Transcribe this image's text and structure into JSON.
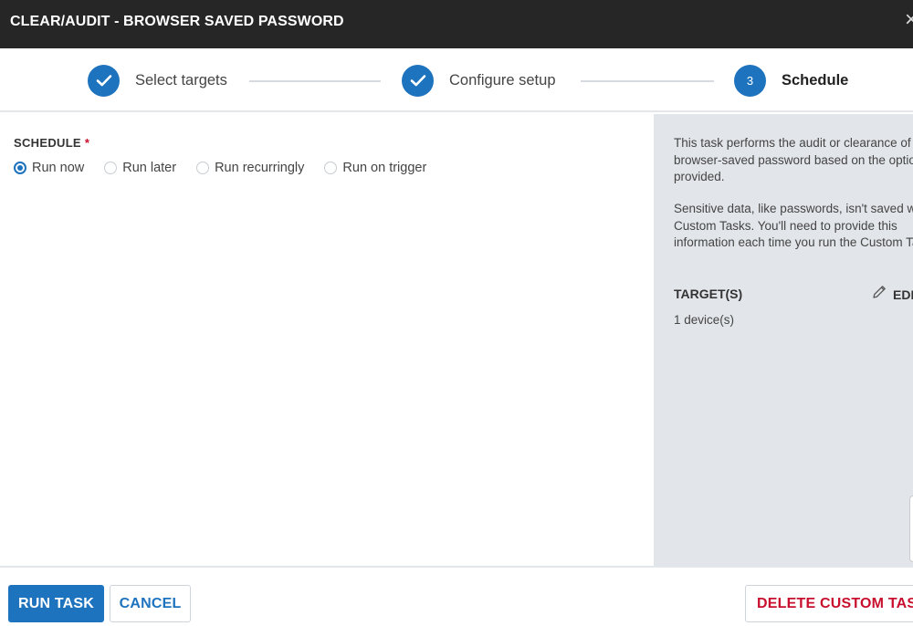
{
  "window": {
    "title": "CLEAR/AUDIT - BROWSER SAVED PASSWORD",
    "close_glyph": "×"
  },
  "stepper": {
    "steps": [
      {
        "label": "Select targets",
        "state": "completed",
        "icon": "check-icon"
      },
      {
        "label": "Configure setup",
        "state": "completed",
        "icon": "check-icon"
      },
      {
        "label": "Schedule",
        "state": "active",
        "number": "3"
      }
    ]
  },
  "schedule": {
    "label": "SCHEDULE",
    "required_marker": "*",
    "options": [
      {
        "label": "Run now",
        "checked": true
      },
      {
        "label": "Run later",
        "checked": false
      },
      {
        "label": "Run recurringly",
        "checked": false
      },
      {
        "label": "Run on trigger",
        "checked": false
      }
    ]
  },
  "info_panel": {
    "description": "This task performs the audit or clearance of the browser-saved password based on the option provided.",
    "sensitive_note": "Sensitive data, like passwords, isn't saved with Custom Tasks. You'll need to provide this information each time you run the Custom Task.",
    "targets_heading": "TARGET(S)",
    "edit_label": "EDIT",
    "targets_count": "1 device(s)"
  },
  "footer": {
    "run_task_label": "RUN TASK",
    "cancel_label": "CANCEL",
    "delete_label": "DELETE CUSTOM TASK"
  },
  "colors": {
    "accent": "#1e73be",
    "titlebar": "#262626",
    "danger": "#c8102e",
    "side_panel": "#e2e5e9"
  }
}
